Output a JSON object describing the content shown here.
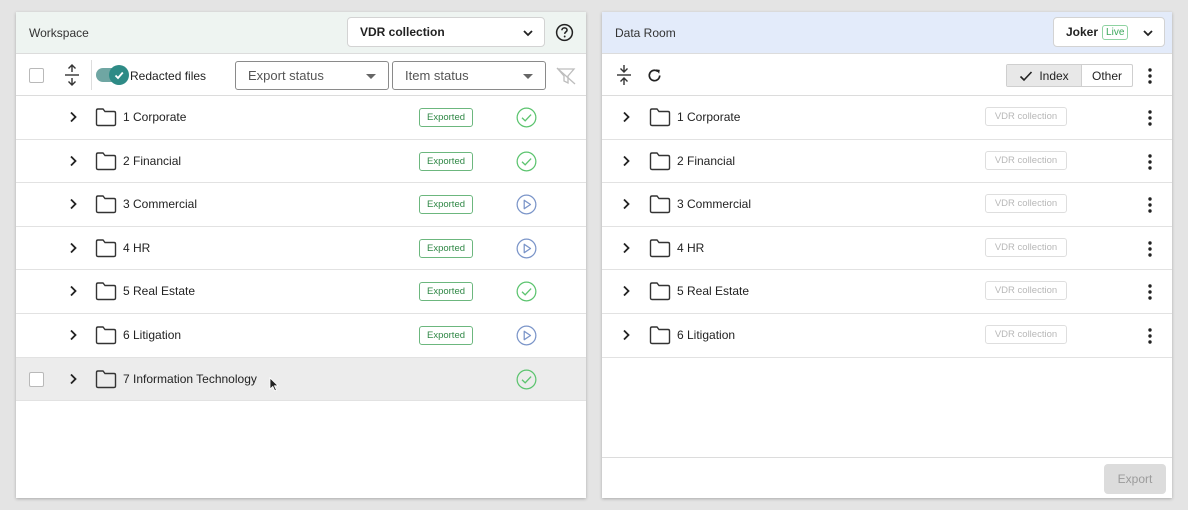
{
  "workspace": {
    "title": "Workspace",
    "collection_select": "VDR collection",
    "toolbar": {
      "redacted_label": "Redacted files",
      "export_status_placeholder": "Export status",
      "item_status_placeholder": "Item status"
    },
    "rows": [
      {
        "label": "1 Corporate",
        "badge": "Exported",
        "status": "done"
      },
      {
        "label": "2 Financial",
        "badge": "Exported",
        "status": "done"
      },
      {
        "label": "3 Commercial",
        "badge": "Exported",
        "status": "play"
      },
      {
        "label": "4 HR",
        "badge": "Exported",
        "status": "play"
      },
      {
        "label": "5 Real Estate",
        "badge": "Exported",
        "status": "done"
      },
      {
        "label": "6 Litigation",
        "badge": "Exported",
        "status": "play"
      },
      {
        "label": "7 Information Technology",
        "badge": "",
        "status": "done"
      }
    ]
  },
  "dataroom": {
    "title": "Data Room",
    "room_select": "Joker",
    "room_badge": "Live",
    "toolbar": {
      "index_label": "Index",
      "other_label": "Other"
    },
    "rows": [
      {
        "label": "1 Corporate",
        "badge": "VDR collection"
      },
      {
        "label": "2 Financial",
        "badge": "VDR collection"
      },
      {
        "label": "3 Commercial",
        "badge": "VDR collection"
      },
      {
        "label": "4 HR",
        "badge": "VDR collection"
      },
      {
        "label": "5 Real Estate",
        "badge": "VDR collection"
      },
      {
        "label": "6 Litigation",
        "badge": "VDR collection"
      }
    ],
    "export_label": "Export"
  },
  "colors": {
    "accent": "#2e8b86",
    "done": "#5cc46f",
    "play": "#7b95c9",
    "exported": "#2f8745"
  }
}
